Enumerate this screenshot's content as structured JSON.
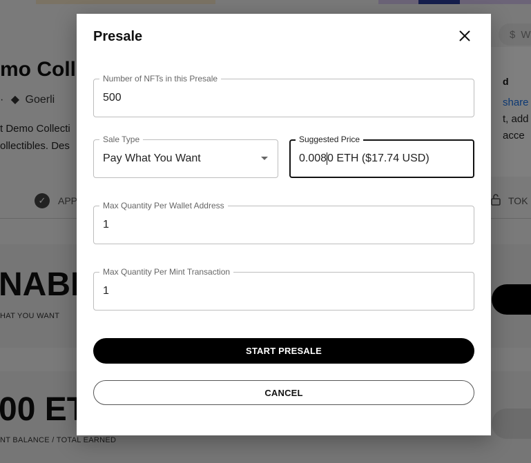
{
  "background": {
    "collection_title": "mo Coll",
    "network_prefix": "·",
    "network": "Goerli",
    "description_line1": "t Demo Collecti",
    "description_line2": "ollectibles. Des",
    "tab_approved": "APP",
    "tab_token": "TOK",
    "status_big": "NABL",
    "status_sub": "HAT YOU WANT",
    "balance_big": "00 ET",
    "balance_sub": "NT BALANCE / TOTAL EARNED",
    "side_heading": "d",
    "side_link": "share",
    "side_line1": "t, add",
    "side_line2": "acce",
    "currency_symbol": "$",
    "currency_letter": "W"
  },
  "modal": {
    "title": "Presale",
    "fields": {
      "nft_count": {
        "label": "Number of NFTs in this Presale",
        "value": "500"
      },
      "sale_type": {
        "label": "Sale Type",
        "value": "Pay What You Want"
      },
      "suggested_price": {
        "label": "Suggested Price",
        "value_before_caret": "0.008",
        "value_after_caret": "0 ETH ($17.74 USD)"
      },
      "max_per_wallet": {
        "label": "Max Quantity Per Wallet Address",
        "value": "1"
      },
      "max_per_tx": {
        "label": "Max Quantity Per Mint Transaction",
        "value": "1"
      }
    },
    "start_button": "START PRESALE",
    "cancel_button": "CANCEL"
  },
  "icons": {
    "close": "close-icon",
    "dropdown": "chevron-down-icon",
    "ethereum": "ethereum-icon",
    "verified": "verified-badge-icon",
    "lock": "lock-icon"
  },
  "colors": {
    "primary_button": "#000000",
    "focused_border": "#111111",
    "link": "#1a73e8"
  }
}
